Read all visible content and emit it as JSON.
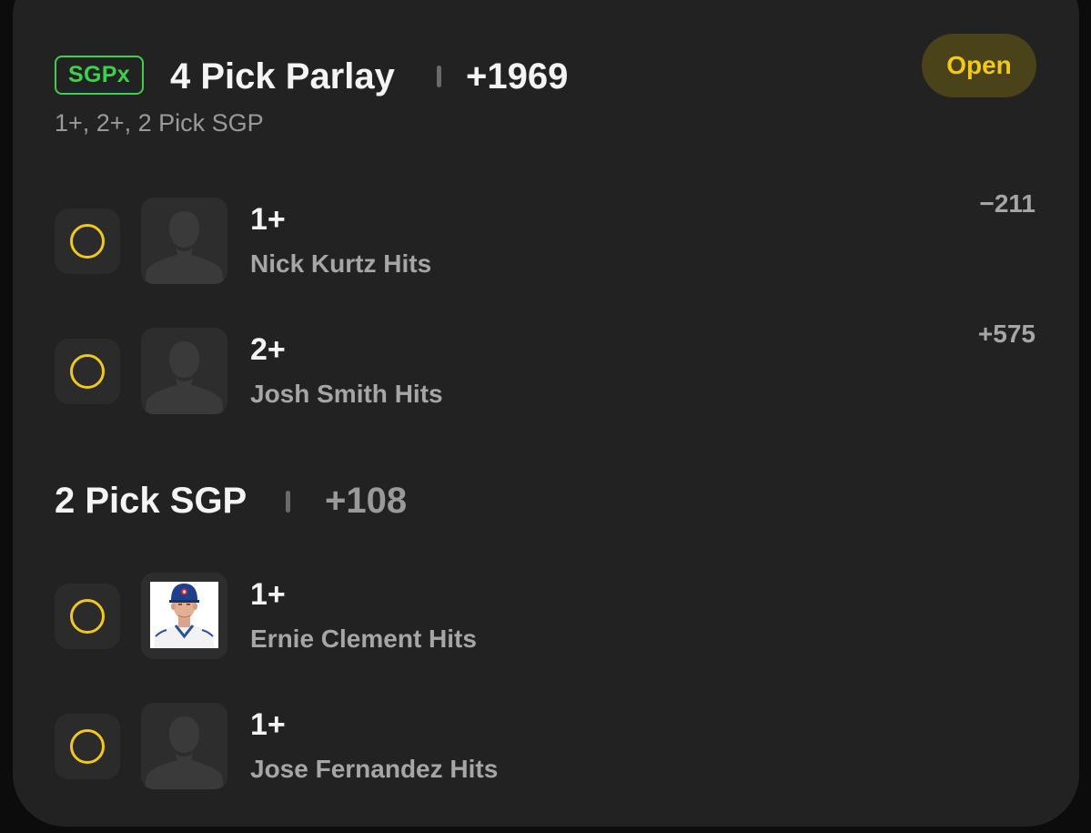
{
  "header": {
    "badge": "SGPx",
    "title": "4 Pick Parlay",
    "odds": "+1969",
    "subtitle": "1+, 2+, 2 Pick SGP",
    "status": "Open"
  },
  "legs": [
    {
      "line": "1+",
      "market": "Nick Kurtz Hits",
      "odds": "−211",
      "avatar": "placeholder-avatar"
    },
    {
      "line": "2+",
      "market": "Josh Smith Hits",
      "odds": "+575",
      "avatar": "placeholder-avatar"
    }
  ],
  "group": {
    "title": "2 Pick SGP",
    "odds": "+108",
    "legs": [
      {
        "line": "1+",
        "market": "Ernie Clement Hits",
        "avatar": "player-photo"
      },
      {
        "line": "1+",
        "market": "Jose Fernandez Hits",
        "avatar": "placeholder-avatar"
      }
    ]
  },
  "colors": {
    "background": "#0c0c0c",
    "card": "#222222",
    "accent_yellow": "#f2c81e",
    "badge_green": "#3ecf4c",
    "status_pill": "#4a4218",
    "text_primary": "#f4f4f4",
    "text_secondary": "#a6a6a6"
  }
}
